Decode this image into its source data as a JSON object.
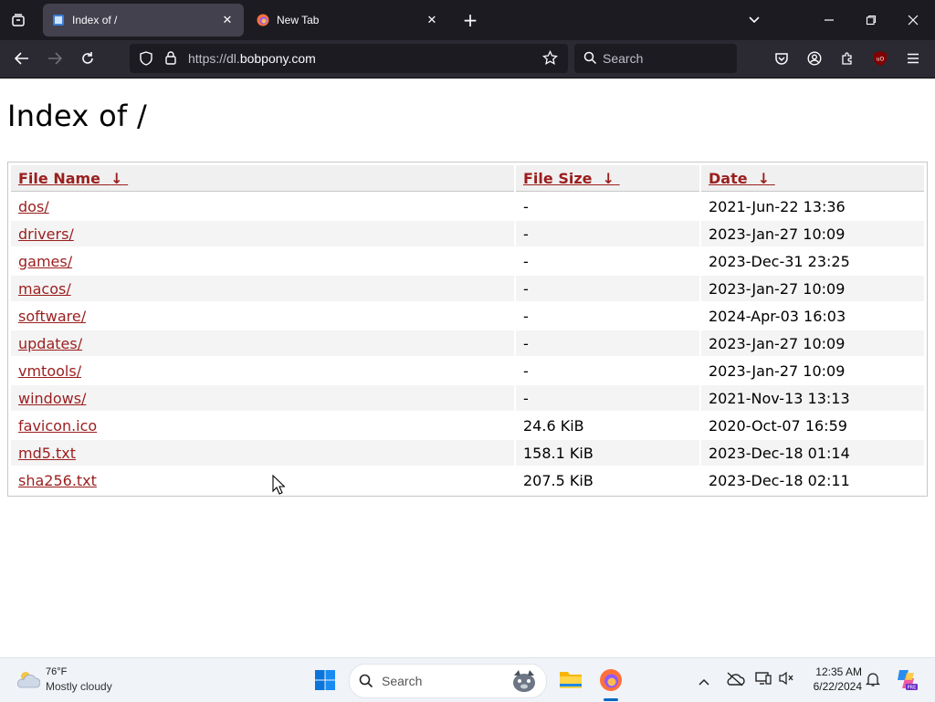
{
  "browser": {
    "tabs": [
      {
        "title": "Index of /",
        "active": true
      },
      {
        "title": "New Tab",
        "active": false
      }
    ],
    "url_prefix": "https://dl.",
    "url_host": "bobpony.com",
    "search_placeholder": "Search"
  },
  "page": {
    "title": "Index of /",
    "columns": [
      {
        "label": "File Name",
        "sort_glyph": "↓"
      },
      {
        "label": "File Size",
        "sort_glyph": "↓"
      },
      {
        "label": "Date",
        "sort_glyph": "↓"
      }
    ],
    "rows": [
      {
        "name": "dos/",
        "size": "-",
        "date": "2021-Jun-22 13:36"
      },
      {
        "name": "drivers/",
        "size": "-",
        "date": "2023-Jan-27 10:09"
      },
      {
        "name": "games/",
        "size": "-",
        "date": "2023-Dec-31 23:25"
      },
      {
        "name": "macos/",
        "size": "-",
        "date": "2023-Jan-27 10:09"
      },
      {
        "name": "software/",
        "size": "-",
        "date": "2024-Apr-03 16:03"
      },
      {
        "name": "updates/",
        "size": "-",
        "date": "2023-Jan-27 10:09"
      },
      {
        "name": "vmtools/",
        "size": "-",
        "date": "2023-Jan-27 10:09"
      },
      {
        "name": "windows/",
        "size": "-",
        "date": "2021-Nov-13 13:13"
      },
      {
        "name": "favicon.ico",
        "size": "24.6 KiB",
        "date": "2020-Oct-07 16:59"
      },
      {
        "name": "md5.txt",
        "size": "158.1 KiB",
        "date": "2023-Dec-18 01:14"
      },
      {
        "name": "sha256.txt",
        "size": "207.5 KiB",
        "date": "2023-Dec-18 02:11"
      }
    ]
  },
  "taskbar": {
    "weather_temp": "76°F",
    "weather_desc": "Mostly cloudy",
    "search_label": "Search",
    "time": "12:35 AM",
    "date": "6/22/2024"
  },
  "colors": {
    "link": "#9b1e1e",
    "tabbar_bg": "#1c1b22",
    "toolbar_bg": "#2b2a33"
  }
}
